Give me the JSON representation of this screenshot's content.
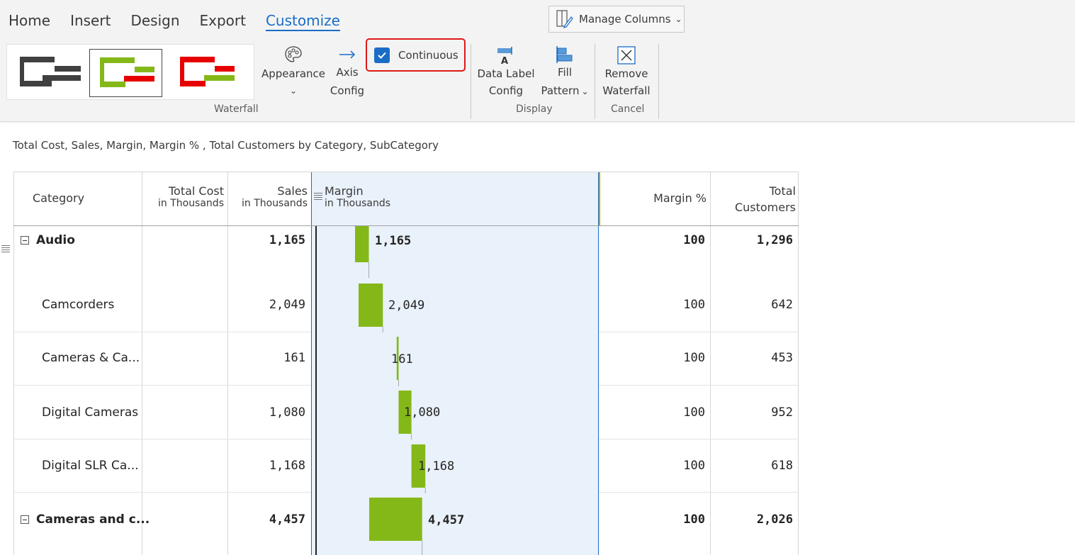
{
  "ribbon": {
    "tabs": [
      {
        "label": "Home",
        "active": false
      },
      {
        "label": "Insert",
        "active": false
      },
      {
        "label": "Design",
        "active": false
      },
      {
        "label": "Export",
        "active": false
      },
      {
        "label": "Customize",
        "active": true
      }
    ],
    "manage_columns_label": "Manage Columns",
    "waterfall_group_label": "Waterfall",
    "appearance_label": "Appearance",
    "axis_config_line1": "Axis",
    "axis_config_line2": "Config",
    "continuous_label": "Continuous",
    "continuous_checked": true,
    "data_label_line1": "Data Label",
    "data_label_line2": "Config",
    "fill_line1": "Fill",
    "fill_line2": "Pattern",
    "display_group_label": "Display",
    "remove_line1": "Remove",
    "remove_line2": "Waterfall",
    "cancel_group_label": "Cancel",
    "style_selected_index": 1
  },
  "subtitle": "Total Cost, Sales, Margin, Margin % , Total Customers by Category, SubCategory",
  "table": {
    "headers": {
      "category": "Category",
      "total_cost": "Total Cost",
      "total_cost_sub": "in Thousands",
      "sales": "Sales",
      "sales_sub": "in Thousands",
      "margin": "Margin",
      "margin_sub": "in Thousands",
      "margin_pct": "Margin %",
      "total_customers_line1": "Total",
      "total_customers_line2": "Customers"
    },
    "rows": [
      {
        "label": "Audio",
        "group": true,
        "sales": "1,165",
        "margin": "1,165",
        "margin_pct": "100",
        "customers": "1,296"
      },
      {
        "label": "Camcorders",
        "group": false,
        "sales": "2,049",
        "margin": "2,049",
        "margin_pct": "100",
        "customers": "642"
      },
      {
        "label": "Cameras & Ca...",
        "group": false,
        "sales": "161",
        "margin": "161",
        "margin_pct": "100",
        "customers": "453"
      },
      {
        "label": "Digital Cameras",
        "group": false,
        "sales": "1,080",
        "margin": "1,080",
        "margin_pct": "100",
        "customers": "952"
      },
      {
        "label": "Digital SLR Ca...",
        "group": false,
        "sales": "1,168",
        "margin": "1,168",
        "margin_pct": "100",
        "customers": "618"
      },
      {
        "label": "Cameras and c...",
        "group": true,
        "sales": "4,457",
        "margin": "4,457",
        "margin_pct": "100",
        "customers": "2,026"
      }
    ]
  },
  "colors": {
    "accent": "#1a6dc7",
    "bar_green": "#84b819",
    "bar_red": "#e60000",
    "bar_dark": "#404040",
    "highlight_border": "#e01818",
    "margin_column_bg": "#e9f1fb"
  },
  "icons": [
    "palette-icon",
    "arrow-right-icon",
    "checkbox-checked-icon",
    "data-label-icon",
    "fill-pattern-icon",
    "remove-waterfall-icon",
    "manage-columns-icon",
    "collapse-icon",
    "hamburger-icon",
    "chevron-down-icon"
  ]
}
